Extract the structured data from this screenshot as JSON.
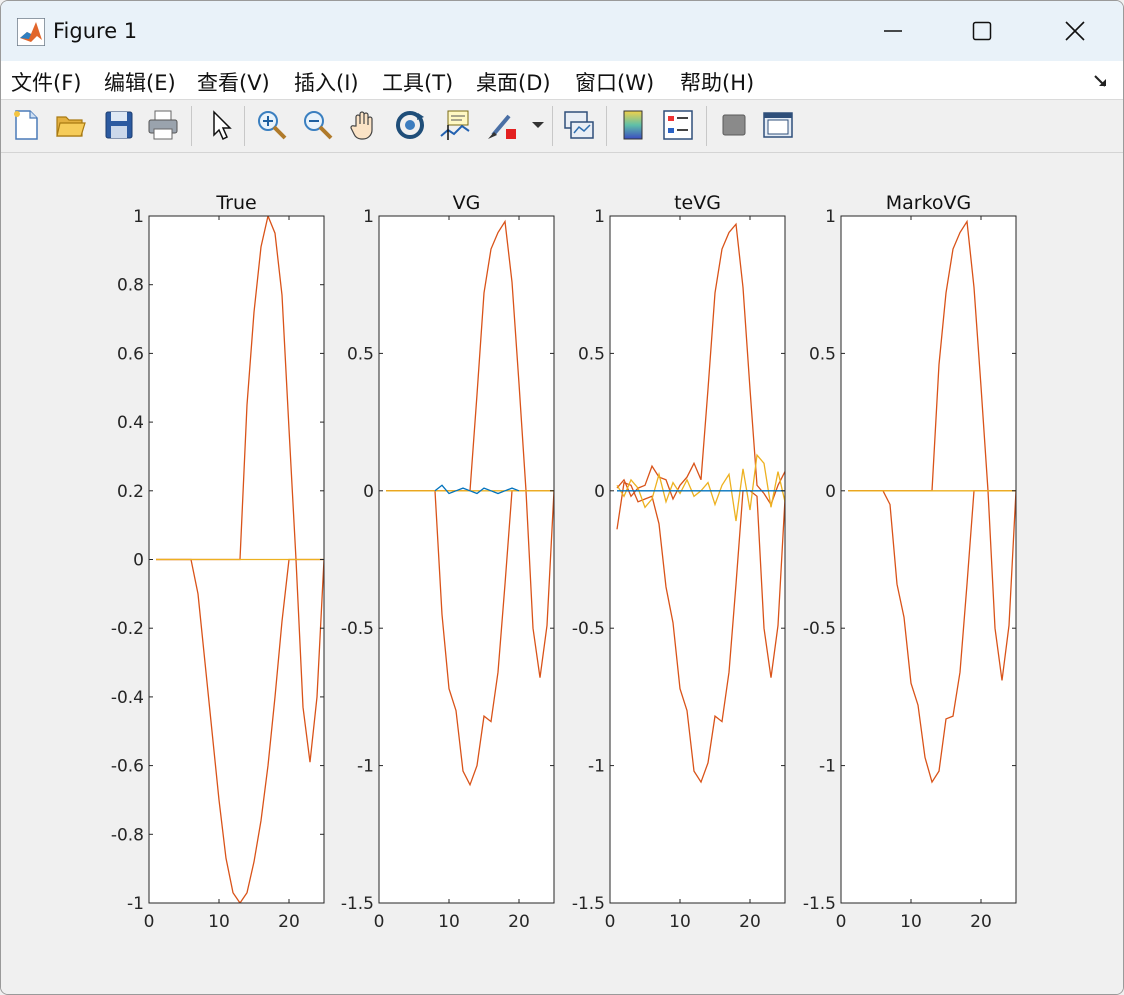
{
  "window": {
    "title": "Figure 1"
  },
  "menu": [
    "文件(F)",
    "编辑(E)",
    "查看(V)",
    "插入(I)",
    "工具(T)",
    "桌面(D)",
    "窗口(W)",
    "帮助(H)"
  ],
  "toolbar": [
    "new-file-icon",
    "open-folder-icon",
    "save-icon",
    "print-icon",
    "pointer-icon",
    "zoom-in-icon",
    "zoom-out-icon",
    "pan-icon",
    "rotate-3d-icon",
    "data-cursor-icon",
    "brush-icon",
    "link-plot-icon",
    "colorbar-icon",
    "legend-icon",
    "hide-plot-tools-icon",
    "show-plot-tools-icon"
  ],
  "colors": {
    "series_main": "#d95319",
    "series_zero": "#edb120",
    "series_blue": "#0072bd"
  },
  "chart_data": [
    {
      "type": "line",
      "title": "True",
      "xlim": [
        0,
        25
      ],
      "ylim": [
        -1,
        1
      ],
      "xticks": [
        "0",
        "10",
        "20"
      ],
      "yticks": [
        "1",
        "0.8",
        "0.6",
        "0.4",
        "0.2",
        "0",
        "-0.2",
        "-0.4",
        "-0.6",
        "-0.8",
        "-1"
      ],
      "series": [
        {
          "x": [
            1,
            2,
            3,
            4,
            5,
            6,
            7,
            8,
            9,
            10,
            11,
            12,
            13,
            14,
            15,
            16,
            17,
            18,
            19,
            20,
            21,
            22,
            23,
            24,
            25
          ],
          "y": [
            0,
            0,
            0,
            0,
            0,
            0,
            -0.1,
            -0.3,
            -0.5,
            -0.7,
            -0.87,
            -0.97,
            -1.0,
            -0.97,
            -0.88,
            -0.76,
            -0.6,
            -0.4,
            -0.18,
            0,
            0,
            -0.43,
            -0.59,
            -0.4,
            0
          ]
        },
        {
          "x": [
            1,
            2,
            3,
            4,
            5,
            6,
            7,
            8,
            9,
            10,
            11,
            12,
            13,
            14,
            15,
            16,
            17,
            18,
            19,
            20,
            21,
            22,
            23,
            24,
            25
          ],
          "y": [
            0,
            0,
            0,
            0,
            0,
            0,
            0,
            0,
            0,
            0,
            0,
            0,
            0,
            0.45,
            0.72,
            0.91,
            1.0,
            0.95,
            0.77,
            0.38,
            0,
            0,
            0,
            0,
            0
          ]
        },
        {
          "x": [
            1,
            25
          ],
          "y": [
            0,
            0
          ]
        }
      ]
    },
    {
      "type": "line",
      "title": "VG",
      "xlim": [
        0,
        25
      ],
      "ylim": [
        -1.5,
        1
      ],
      "xticks": [
        "0",
        "10",
        "20"
      ],
      "yticks": [
        "1",
        "0.5",
        "0",
        "-0.5",
        "-1",
        "-1.5"
      ],
      "series": [
        {
          "x": [
            1,
            2,
            3,
            4,
            5,
            6,
            7,
            8,
            9,
            10,
            11,
            12,
            13,
            14,
            15,
            16,
            17,
            18,
            19,
            20,
            21,
            22,
            23,
            24,
            25
          ],
          "y": [
            0,
            0,
            0,
            0,
            0,
            0,
            0,
            0,
            -0.45,
            -0.72,
            -0.8,
            -1.02,
            -1.07,
            -1.0,
            -0.82,
            -0.84,
            -0.66,
            -0.34,
            0,
            0,
            0,
            -0.5,
            -0.68,
            -0.49,
            0
          ]
        },
        {
          "x": [
            1,
            2,
            3,
            4,
            5,
            6,
            7,
            8,
            9,
            10,
            11,
            12,
            13,
            14,
            15,
            16,
            17,
            18,
            19,
            20,
            21,
            22,
            23,
            24,
            25
          ],
          "y": [
            0,
            0,
            0,
            0,
            0,
            0,
            0,
            0,
            0,
            0,
            0,
            0,
            0,
            0.35,
            0.72,
            0.88,
            0.94,
            0.98,
            0.76,
            0.39,
            0,
            0,
            0,
            0,
            0
          ]
        },
        {
          "x": [
            1,
            25
          ],
          "y": [
            0,
            0
          ]
        },
        {
          "x": [
            8,
            9,
            10,
            11,
            12,
            13,
            14,
            15,
            16,
            17,
            18,
            19,
            20
          ],
          "y": [
            0,
            0.02,
            -0.01,
            0,
            0.01,
            0,
            -0.01,
            0.01,
            0,
            -0.01,
            0,
            0.01,
            0
          ]
        }
      ]
    },
    {
      "type": "line",
      "title": "teVG",
      "xlim": [
        0,
        25
      ],
      "ylim": [
        -1.5,
        1
      ],
      "xticks": [
        "0",
        "10",
        "20"
      ],
      "yticks": [
        "1",
        "0.5",
        "0",
        "-0.5",
        "-1",
        "-1.5"
      ],
      "series": [
        {
          "x": [
            1,
            2,
            3,
            4,
            5,
            6,
            7,
            8,
            9,
            10,
            11,
            12,
            13,
            14,
            15,
            16,
            17,
            18,
            19,
            20,
            21,
            22,
            23,
            24,
            25
          ],
          "y": [
            -0.14,
            0.03,
            0.02,
            -0.04,
            -0.03,
            -0.02,
            -0.12,
            -0.35,
            -0.48,
            -0.72,
            -0.8,
            -1.02,
            -1.06,
            -0.99,
            -0.82,
            -0.84,
            -0.66,
            -0.34,
            0,
            0,
            -0.02,
            -0.5,
            -0.68,
            -0.49,
            -0.03
          ]
        },
        {
          "x": [
            1,
            2,
            3,
            4,
            5,
            6,
            7,
            8,
            9,
            10,
            11,
            12,
            13,
            14,
            15,
            16,
            17,
            18,
            19,
            20,
            21,
            22,
            23,
            24,
            25
          ],
          "y": [
            0.01,
            0.04,
            -0.02,
            0.01,
            0.02,
            0.09,
            0.05,
            0.04,
            -0.03,
            0.02,
            0.05,
            0.1,
            0.04,
            0.37,
            0.72,
            0.88,
            0.94,
            0.97,
            0.74,
            0.37,
            0.02,
            -0.01,
            -0.05,
            0.02,
            0.07
          ]
        },
        {
          "x": [
            1,
            2,
            3,
            4,
            5,
            6,
            7,
            8,
            9,
            10,
            11,
            12,
            13,
            14,
            15,
            16,
            17,
            18,
            19,
            20,
            21,
            22,
            23,
            24,
            25
          ],
          "y": [
            0.02,
            -0.02,
            0.04,
            0.01,
            -0.06,
            -0.03,
            0.06,
            -0.04,
            0.03,
            -0.01,
            0.04,
            -0.02,
            0,
            0.03,
            -0.05,
            0.02,
            0.06,
            -0.11,
            0.08,
            -0.07,
            0.13,
            0.1,
            -0.06,
            0.07,
            -0.04
          ]
        },
        {
          "x": [
            1,
            25
          ],
          "y": [
            0,
            0
          ]
        }
      ]
    },
    {
      "type": "line",
      "title": "MarkoVG",
      "xlim": [
        0,
        25
      ],
      "ylim": [
        -1.5,
        1
      ],
      "xticks": [
        "0",
        "10",
        "20"
      ],
      "yticks": [
        "1",
        "0.5",
        "0",
        "-0.5",
        "-1",
        "-1.5"
      ],
      "series": [
        {
          "x": [
            1,
            2,
            3,
            4,
            5,
            6,
            7,
            8,
            9,
            10,
            11,
            12,
            13,
            14,
            15,
            16,
            17,
            18,
            19,
            20,
            21,
            22,
            23,
            24,
            25
          ],
          "y": [
            0,
            0,
            0,
            0,
            0,
            0,
            -0.05,
            -0.34,
            -0.46,
            -0.7,
            -0.78,
            -0.97,
            -1.06,
            -1.02,
            -0.83,
            -0.82,
            -0.66,
            -0.34,
            0,
            0,
            0,
            -0.5,
            -0.69,
            -0.49,
            0
          ]
        },
        {
          "x": [
            1,
            2,
            3,
            4,
            5,
            6,
            7,
            8,
            9,
            10,
            11,
            12,
            13,
            14,
            15,
            16,
            17,
            18,
            19,
            20,
            21,
            22,
            23,
            24,
            25
          ],
          "y": [
            0,
            0,
            0,
            0,
            0,
            0,
            0,
            0,
            0,
            0,
            0,
            0,
            0,
            0.46,
            0.72,
            0.88,
            0.94,
            0.98,
            0.74,
            0.38,
            0,
            0,
            0,
            0,
            0
          ]
        },
        {
          "x": [
            1,
            25
          ],
          "y": [
            0,
            0
          ]
        }
      ]
    }
  ]
}
